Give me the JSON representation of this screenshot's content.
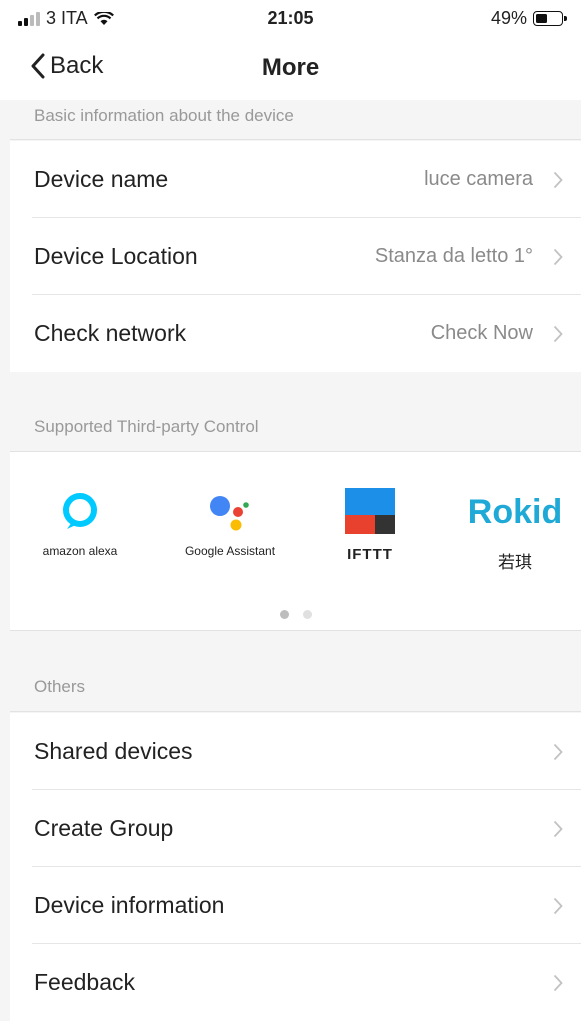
{
  "status_bar": {
    "carrier": "3 ITA",
    "time": "21:05",
    "battery_percent": "49%",
    "battery_level": 0.49
  },
  "nav": {
    "back_label": "Back",
    "title": "More"
  },
  "basic": {
    "header": "Basic information about the device",
    "rows": [
      {
        "label": "Device name",
        "value": "luce camera"
      },
      {
        "label": "Device Location",
        "value": "Stanza da letto 1°"
      },
      {
        "label": "Check network",
        "value": "Check Now"
      }
    ]
  },
  "third_party": {
    "header": "Supported Third-party Control",
    "partners": [
      {
        "name": "amazon alexa",
        "icon": "alexa-icon"
      },
      {
        "name": "Google Assistant",
        "icon": "google-assistant-icon"
      },
      {
        "name": "IFTTT",
        "icon": "ifttt-icon"
      },
      {
        "name": "若琪",
        "logo_text": "Rokid",
        "icon": "rokid-icon"
      }
    ],
    "pages": 2,
    "current_page": 1
  },
  "others": {
    "header": "Others",
    "rows": [
      {
        "label": "Shared devices"
      },
      {
        "label": "Create Group"
      },
      {
        "label": "Device information"
      },
      {
        "label": "Feedback"
      }
    ]
  },
  "colors": {
    "alexa": "#00caff",
    "rokid": "#1fa9d6",
    "ifttt_blue": "#1c8fe8",
    "ifttt_red": "#e8412e"
  }
}
